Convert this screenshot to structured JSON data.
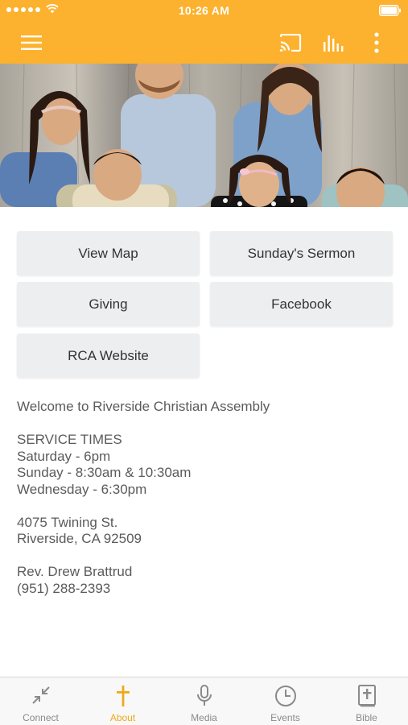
{
  "status_bar": {
    "time": "10:26 AM"
  },
  "app_bar": {
    "menu_icon": "hamburger-menu-icon",
    "cast_icon": "cast-icon",
    "equalizer_icon": "equalizer-icon",
    "more_icon": "more-vertical-icon"
  },
  "colors": {
    "accent": "#fcb22e",
    "tab_active": "#f0a81d",
    "button_bg": "#eceeef",
    "text": "#5b5b5b"
  },
  "hero": {
    "alt": "Family photo banner"
  },
  "buttons": {
    "view_map": "View Map",
    "sermon": "Sunday's Sermon",
    "giving": "Giving",
    "facebook": "Facebook",
    "website": "RCA Website"
  },
  "info": {
    "welcome": "Welcome to Riverside Christian Assembly",
    "service_times_heading": "SERVICE TIMES",
    "saturday": "Saturday - 6pm",
    "sunday": "Sunday - 8:30am & 10:30am",
    "wednesday": "Wednesday - 6:30pm",
    "street": "4075 Twining St.",
    "city": "Riverside, CA 92509",
    "pastor": "Rev. Drew Brattrud",
    "phone": "(951) 288-2393"
  },
  "tabs": [
    {
      "label": "Connect",
      "icon": "connect-arrows-icon",
      "active": false
    },
    {
      "label": "About",
      "icon": "cross-icon",
      "active": true
    },
    {
      "label": "Media",
      "icon": "microphone-icon",
      "active": false
    },
    {
      "label": "Events",
      "icon": "clock-icon",
      "active": false
    },
    {
      "label": "Bible",
      "icon": "bible-icon",
      "active": false
    }
  ]
}
